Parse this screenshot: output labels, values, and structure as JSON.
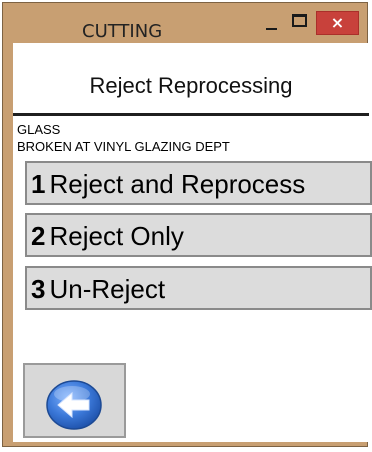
{
  "window": {
    "title": "CUTTING",
    "close_glyph": "×"
  },
  "header": {
    "title": "Reject Reprocessing"
  },
  "info": {
    "line1": "GLASS",
    "line2": "BROKEN AT VINYL GLAZING DEPT"
  },
  "options": [
    {
      "number": "1",
      "label": "Reject and Reprocess"
    },
    {
      "number": "2",
      "label": "Reject Only"
    },
    {
      "number": "3",
      "label": "Un-Reject"
    }
  ],
  "back": {
    "icon": "back-arrow-icon"
  },
  "colors": {
    "frame": "#c89f72",
    "close": "#c8413b",
    "button_face": "#dcdcdc",
    "back_circle": "#3b78d8"
  }
}
